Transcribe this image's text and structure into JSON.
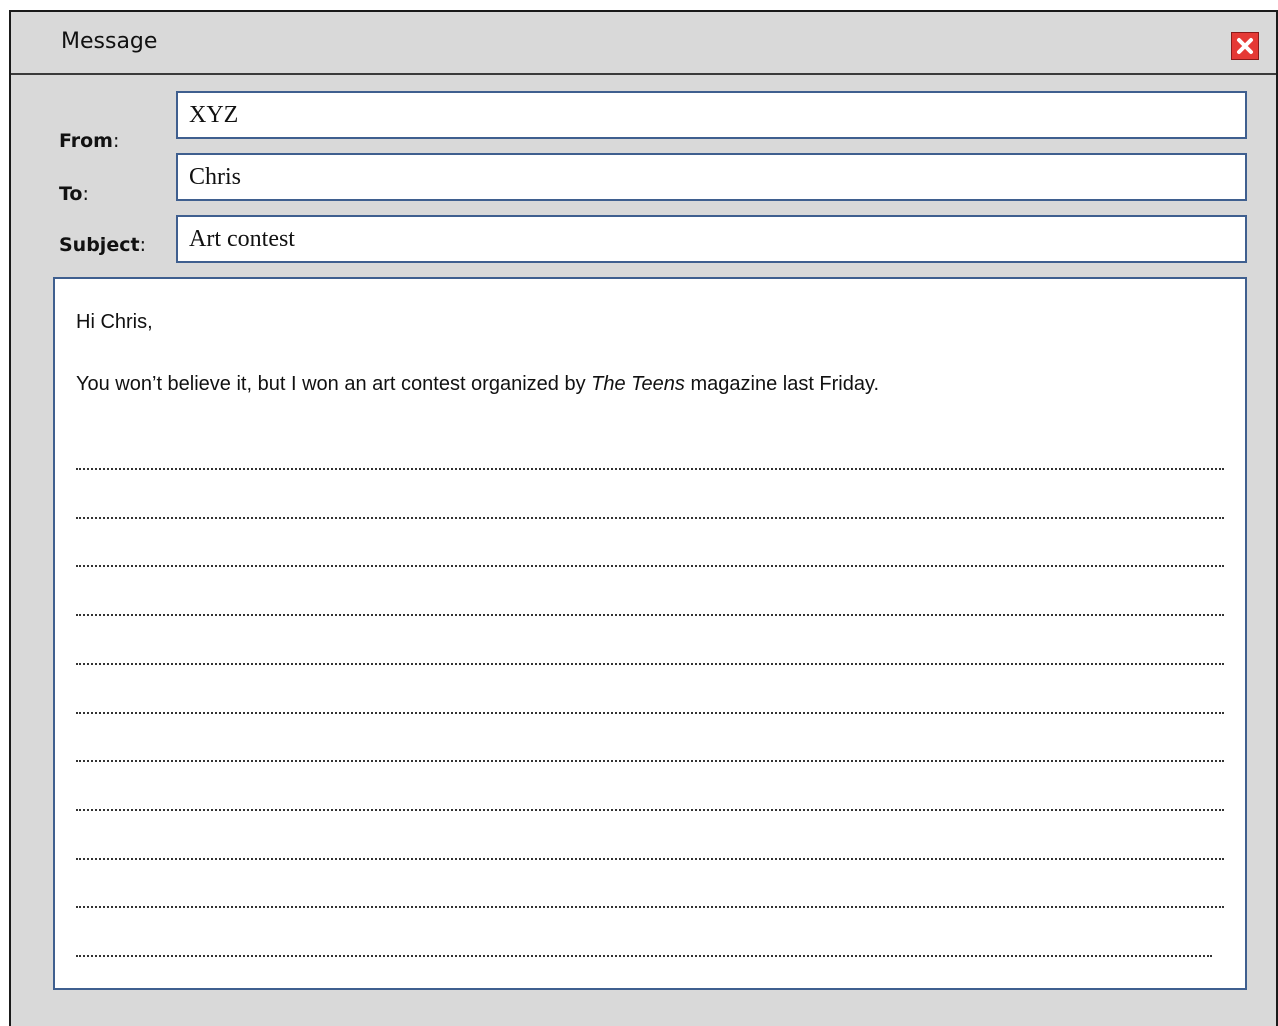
{
  "window": {
    "title": "Message",
    "close_icon": "close-icon"
  },
  "fields": {
    "from": {
      "label": "From",
      "colon": ":",
      "value": "XYZ"
    },
    "to": {
      "label": "To",
      "colon": ":",
      "value": "Chris"
    },
    "subject": {
      "label": "Subject",
      "colon": ":",
      "value": "Art contest"
    }
  },
  "body": {
    "greeting": "Hi Chris,",
    "line_before": "You won’t believe it, but I won an art contest organized by ",
    "line_italic": "The Teens",
    "line_after": " magazine last Friday.",
    "blank_lines": 11
  },
  "colors": {
    "background": "#d9d9d9",
    "field_border": "#3f5f8f",
    "close_button": "#e53935"
  }
}
